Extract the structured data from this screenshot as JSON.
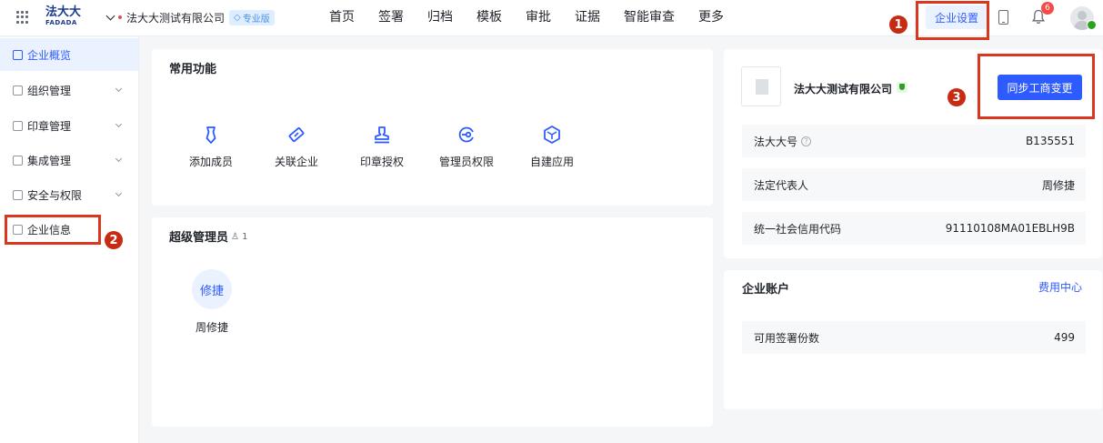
{
  "topbar": {
    "logo_text": "法大大",
    "logo_sub": "FADADA",
    "company_name": "法大大测试有限公司",
    "plan_badge": "专业版",
    "nav": [
      "首页",
      "签署",
      "归档",
      "模板",
      "审批",
      "证据",
      "智能审查",
      "更多"
    ],
    "settings_label": "企业设置",
    "notification_count": "6"
  },
  "sidebar": {
    "items": [
      {
        "label": "企业概览",
        "icon": "overview-icon"
      },
      {
        "label": "组织管理",
        "icon": "org-icon"
      },
      {
        "label": "印章管理",
        "icon": "seal-icon"
      },
      {
        "label": "集成管理",
        "icon": "integration-icon"
      },
      {
        "label": "安全与权限",
        "icon": "security-icon"
      },
      {
        "label": "企业信息",
        "icon": "company-info-icon"
      }
    ]
  },
  "common_functions": {
    "title": "常用功能",
    "items": [
      {
        "label": "添加成员",
        "icon": "add-member-icon"
      },
      {
        "label": "关联企业",
        "icon": "link-company-icon"
      },
      {
        "label": "印章授权",
        "icon": "seal-auth-icon"
      },
      {
        "label": "管理员权限",
        "icon": "admin-key-icon"
      },
      {
        "label": "自建应用",
        "icon": "cube-icon"
      }
    ]
  },
  "super_admin": {
    "title": "超级管理员",
    "count": "1",
    "avatar_text": "修捷",
    "name": "周修捷"
  },
  "company_card": {
    "name": "法大大测试有限公司",
    "sync_button": "同步工商变更",
    "rows": [
      {
        "label": "法大大号",
        "value": "B135551"
      },
      {
        "label": "法定代表人",
        "value": "周修捷"
      },
      {
        "label": "统一社会信用代码",
        "value": "91110108MA01EBLH9B"
      }
    ]
  },
  "account_card": {
    "title": "企业账户",
    "link": "费用中心",
    "rows": [
      {
        "label": "可用签署份数",
        "value": "499"
      }
    ]
  },
  "annotations": [
    "1",
    "2",
    "3"
  ],
  "colors": {
    "accent": "#2e5bff",
    "annotation": "#d9381e",
    "badge": "#f54a45"
  }
}
